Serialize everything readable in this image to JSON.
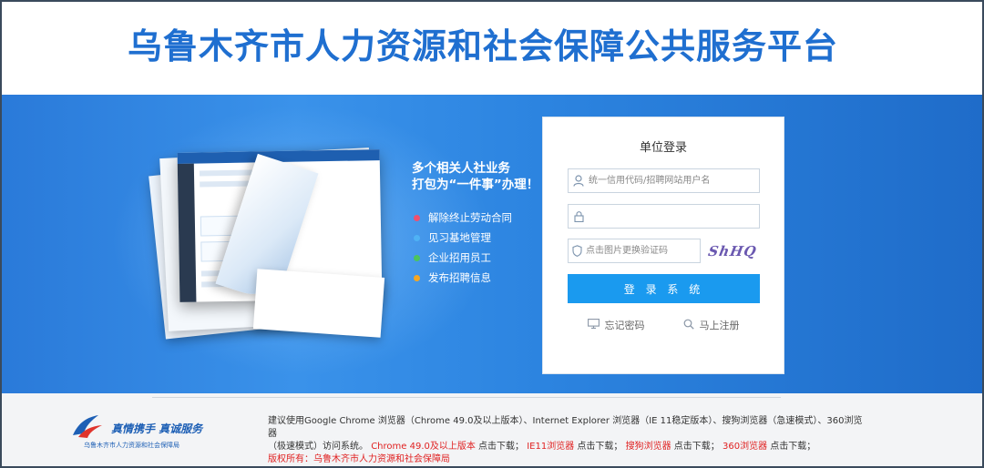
{
  "header": {
    "title": "乌鲁木齐市人力资源和社会保障公共服务平台"
  },
  "banner": {
    "slogan_line1": "多个相关人社业务",
    "slogan_line2": "打包为“一件事”办理！",
    "features": [
      {
        "label": "解除终止劳动合同",
        "color": "#f0506e"
      },
      {
        "label": "见习基地管理",
        "color": "#4fb2f5"
      },
      {
        "label": "企业招用员工",
        "color": "#4cc45c"
      },
      {
        "label": "发布招聘信息",
        "color": "#f5a623"
      }
    ]
  },
  "login": {
    "title": "单位登录",
    "username_placeholder": "统一信用代码/招聘网站用户名",
    "password_placeholder": "",
    "captcha_placeholder": "点击图片更换验证码",
    "captcha_text": "ShHQ",
    "submit_label": "登 录 系 统",
    "forgot_label": "忘记密码",
    "register_label": "马上注册"
  },
  "footer": {
    "brand_slogan": "真情携手 真诚服务",
    "brand_org": "乌鲁木齐市人力资源和社会保障局",
    "notice_line1": "建议使用Google Chrome 浏览器（Chrome 49.0及以上版本）、Internet Explorer 浏览器（IE 11稳定版本）、搜狗浏览器（急速模式）、360浏览器",
    "notice_line2_a": "（极速模式）访问系统。",
    "dl_chrome": "Chrome 49.0及以上版本",
    "dl_click": "点击下载；",
    "dl_ie": "IE11浏览器",
    "dl_sogou": "搜狗浏览器",
    "dl_360": "360浏览器",
    "copyright": "版权所有：乌鲁木齐市人力资源和社会保障局"
  }
}
